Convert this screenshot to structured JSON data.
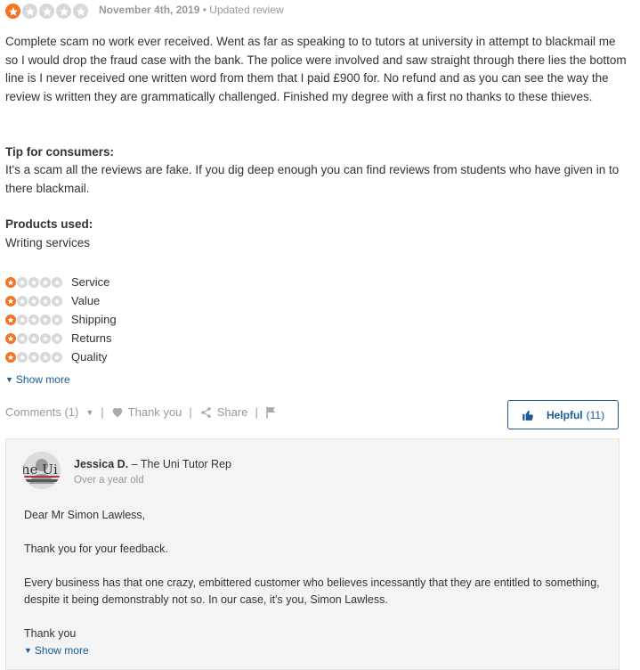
{
  "review": {
    "rating": 1,
    "max_rating": 5,
    "date": "November 4th, 2019",
    "separator": "•",
    "status": "Updated review",
    "text": "Complete scam no work ever received. Went as far as speaking to to tutors at university in attempt to blackmail me so I would drop the fraud case with the bank. The police were involved and saw straight through there lies the bottom line is I never received one written word from them that I paid £900 for. No refund and as you can see the way the review is written they are grammatically challenged. Finished my degree with a first no thanks to these thieves.",
    "tip_title": "Tip for consumers:",
    "tip_text": "It's a scam all the reviews are fake. If you dig deep enough you can find reviews from students who have given in to there blackmail.",
    "products_title": "Products used:",
    "products_text": "Writing services",
    "sub_ratings": [
      {
        "label": "Service",
        "value": 1
      },
      {
        "label": "Value",
        "value": 1
      },
      {
        "label": "Shipping",
        "value": 1
      },
      {
        "label": "Returns",
        "value": 1
      },
      {
        "label": "Quality",
        "value": 1
      }
    ],
    "show_more": "Show more"
  },
  "actions": {
    "comments": "Comments (1)",
    "thank_you": "Thank you",
    "share": "Share",
    "helpful_label": "Helpful",
    "helpful_count": "(11)"
  },
  "reply": {
    "author": "Jessica D.",
    "role": "– The Uni Tutor Rep",
    "age": "Over a year old",
    "avatar_text": "he Ui",
    "paragraphs": [
      "Dear Mr Simon Lawless,",
      "Thank you for your feedback.",
      "Every business has that one crazy, embittered customer who believes incessantly that they are entitled to something, despite it being demonstrably not so. In our case, it's you, Simon Lawless.",
      "Thank you"
    ],
    "show_more": "Show more"
  },
  "colors": {
    "accent_star": "#f47521",
    "empty_star": "#d8d8d8",
    "link": "#1a5a96",
    "muted": "#999999",
    "text": "#333333"
  }
}
